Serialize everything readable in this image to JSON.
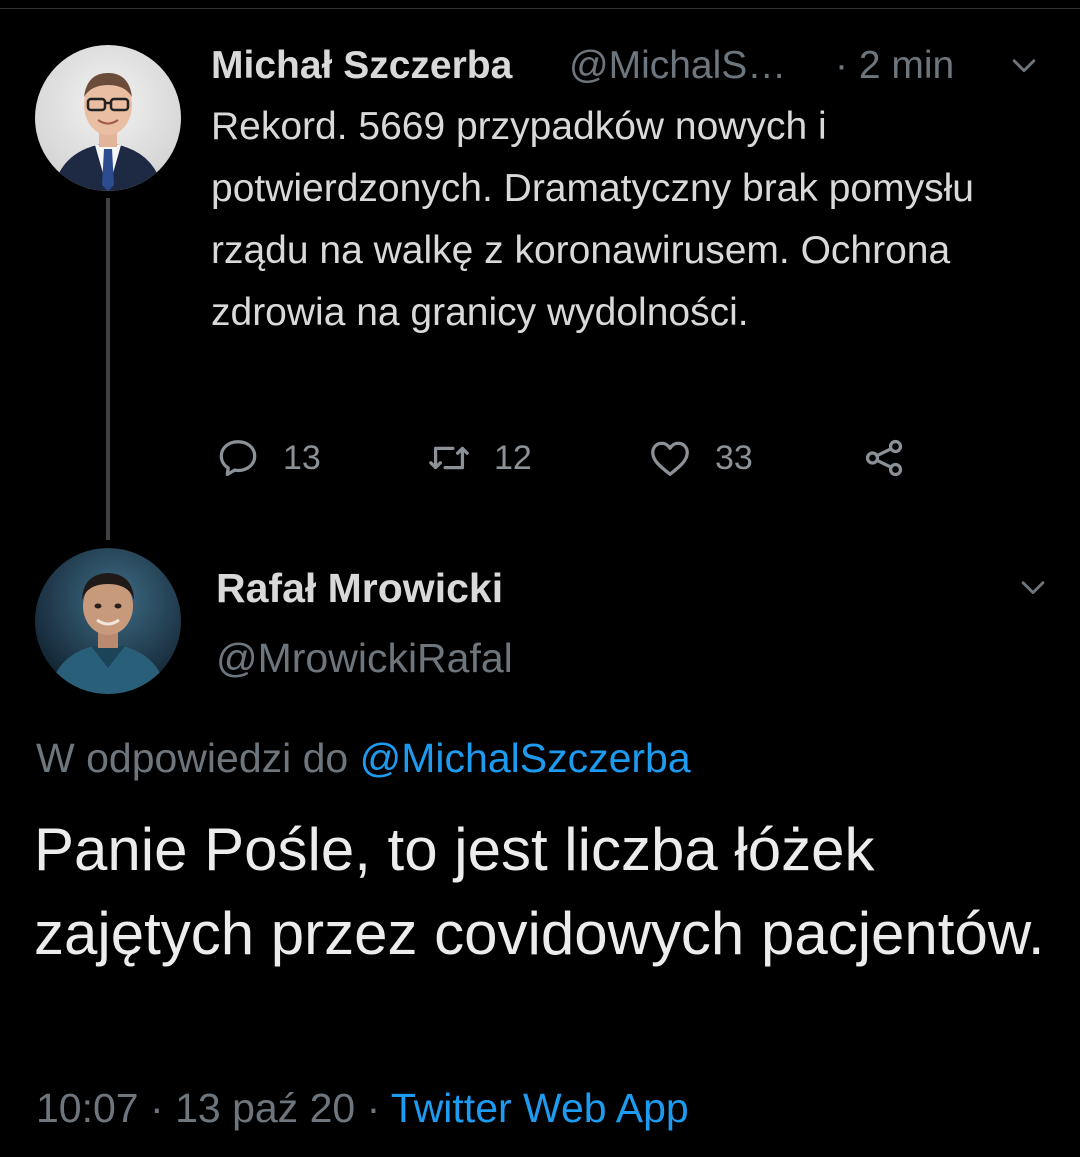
{
  "parent_tweet": {
    "author_name": "Michał Szczerba",
    "author_handle": "@MichalS…",
    "time": "· 2 min",
    "text": "Rekord. 5669 przypadków nowych i potwierdzonych. Dramatyczny brak pomysłu rządu na walkę z koronawirusem. Ochrona zdrowia na granicy wydolności.",
    "replies": "13",
    "retweets": "12",
    "likes": "33"
  },
  "reply_tweet": {
    "author_name": "Rafał Mrowicki",
    "author_handle": "@MrowickiRafal",
    "replying_prefix": "W odpowiedzi do",
    "replying_to": "@MichalSzczerba",
    "text": "Panie Pośle, to jest liczba łóżek zajętych przez covidowych pacjentów.",
    "time": "10:07",
    "date": "13 paź 20",
    "source": "Twitter Web App"
  },
  "icons": {
    "reply": "reply-icon",
    "retweet": "retweet-icon",
    "like": "heart-icon",
    "share": "share-icon",
    "more": "chevron-down-icon"
  },
  "colors": {
    "background": "#000000",
    "text": "#d9d9d9",
    "secondary": "#6e767d",
    "link": "#1d9bf0"
  }
}
